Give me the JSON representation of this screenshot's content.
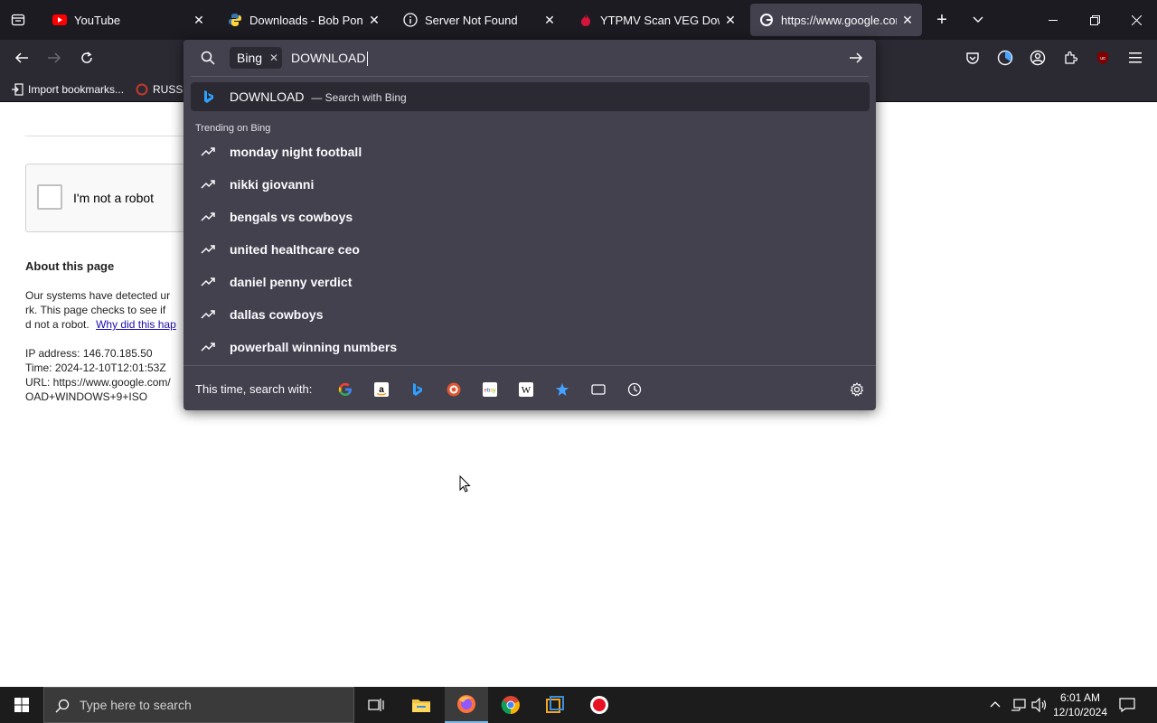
{
  "tabs": [
    {
      "title": "YouTube",
      "icon": "youtube-icon"
    },
    {
      "title": "Downloads - Bob Pony",
      "icon": "python-icon"
    },
    {
      "title": "Server Not Found",
      "icon": "info-icon"
    },
    {
      "title": "YTPMV Scan VEG Downloa",
      "icon": "fire-icon"
    },
    {
      "title": "https://www.google.com/",
      "icon": "google-icon",
      "active": true
    }
  ],
  "bookmarks": [
    {
      "label": "Import bookmarks...",
      "icon": "import-icon"
    },
    {
      "label": "RUSSIA",
      "icon": "bookmark-icon"
    }
  ],
  "urlbar": {
    "engine_chip": "Bing",
    "query": "DOWNLOAD",
    "selected_suggestion": {
      "text": "DOWNLOAD",
      "suffix": "— Search with Bing"
    },
    "trending_label": "Trending on Bing",
    "trending": [
      "monday night football",
      "nikki giovanni",
      "bengals vs cowboys",
      "united healthcare ceo",
      "daniel penny verdict",
      "dallas cowboys",
      "powerball winning numbers"
    ],
    "one_off_label": "This time, search with:",
    "engines": [
      "google-icon",
      "amazon-icon",
      "bing-icon",
      "duckduckgo-icon",
      "ebay-icon",
      "wikipedia-icon",
      "bookmarks-star-icon",
      "tabs-icon",
      "history-icon"
    ]
  },
  "page": {
    "captcha_label": "I'm not a robot",
    "about_heading": "About this page",
    "line1": "Our systems have detected ur",
    "line2": "rk. This page checks to see if",
    "line3_prefix": "d not a robot.",
    "line3_link": "Why did this hap",
    "ip": "IP address: 146.70.185.50",
    "time": "Time: 2024-12-10T12:01:53Z",
    "url": "URL: https://www.google.com/",
    "url_tail": "OAD+WINDOWS+9+ISO"
  },
  "taskbar": {
    "search_placeholder": "Type here to search",
    "time": "6:01 AM",
    "date": "12/10/2024"
  },
  "colors": {
    "tab_bg": "#1c1b22",
    "toolbar_bg": "#2b2a33",
    "panel_bg": "#42414d",
    "text": "#fbfbfe",
    "link": "#1a0dab"
  }
}
